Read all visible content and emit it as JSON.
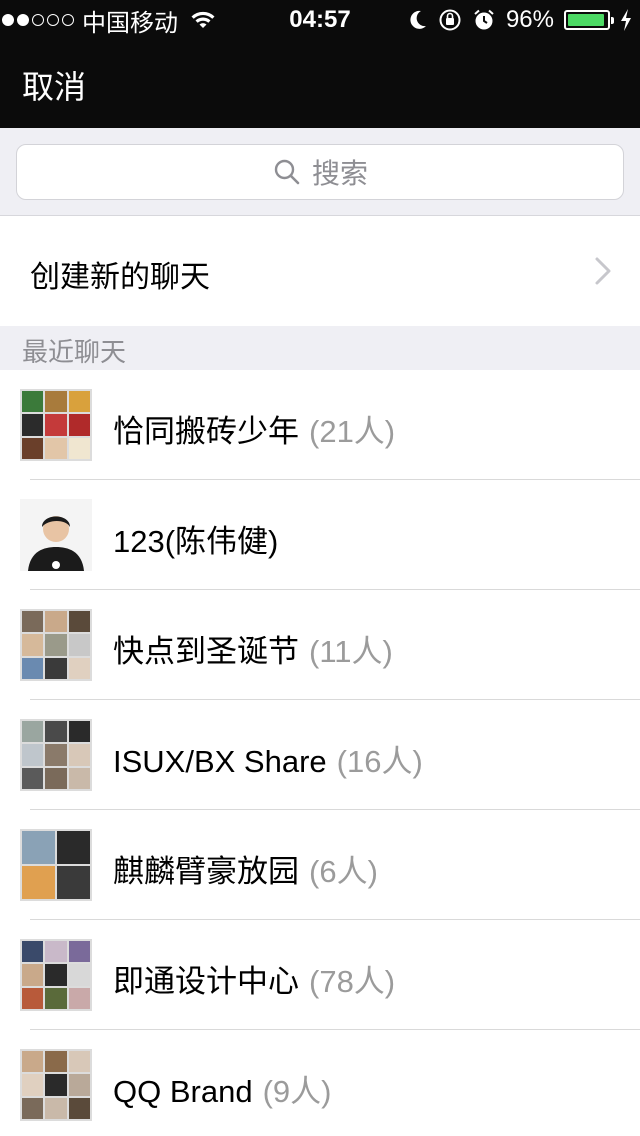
{
  "status_bar": {
    "signal_dots": [
      true,
      true,
      false,
      false,
      false
    ],
    "carrier": "中国移动",
    "time": "04:57",
    "battery_percent": "96%",
    "battery_level": 0.96,
    "icons": [
      "wifi-icon",
      "moon-icon",
      "rotation-lock-icon",
      "alarm-icon",
      "charging-icon"
    ]
  },
  "nav": {
    "cancel_label": "取消"
  },
  "search": {
    "placeholder": "搜索"
  },
  "create": {
    "label": "创建新的聊天"
  },
  "recent": {
    "title": "最近聊天"
  },
  "chats": [
    {
      "name": "恰同搬砖少年",
      "count": "(21人)",
      "grid": 3,
      "tiles": [
        "#3b7a3a",
        "#a87b3c",
        "#d9a13c",
        "#2b2b2b",
        "#c43a3a",
        "#b02a2a",
        "#6a3f2a",
        "#e2c6a8",
        "#f0e6d0"
      ]
    },
    {
      "name": "123(陈伟健)",
      "count": "",
      "grid": 1,
      "tiles": []
    },
    {
      "name": "快点到圣诞节",
      "count": "(11人)",
      "grid": 3,
      "tiles": [
        "#7a6a5a",
        "#c9a98a",
        "#5a4a3a",
        "#d6b99a",
        "#9a9a8a",
        "#c8c8c8",
        "#6a8ab0",
        "#3a3a3a",
        "#e0d0c0"
      ]
    },
    {
      "name": "ISUX/BX Share",
      "count": "(16人)",
      "grid": 3,
      "tiles": [
        "#9aa6a0",
        "#4a4a4a",
        "#2a2a2a",
        "#bfc6cc",
        "#8a7a6a",
        "#d8c8b8",
        "#5a5a5a",
        "#7a6a5a",
        "#c9b9a9"
      ]
    },
    {
      "name": "麒麟臂豪放园",
      "count": "(6人)",
      "grid": 2,
      "tiles": [
        "#8aa2b6",
        "#2a2a2a",
        "#e0a050",
        "#3a3a3a"
      ]
    },
    {
      "name": "即通设计中心",
      "count": "(78人)",
      "grid": 3,
      "tiles": [
        "#3a4a6a",
        "#c9b9c9",
        "#7a6a9a",
        "#c9a98a",
        "#2a2a2a",
        "#d8d8d8",
        "#b85a3a",
        "#5a6a3a",
        "#c9a9a9"
      ]
    },
    {
      "name": "QQ Brand",
      "count": "(9人)",
      "grid": 3,
      "tiles": [
        "#c9a98a",
        "#8a6a4a",
        "#d8c8b8",
        "#e0d0c0",
        "#2a2a2a",
        "#b9a999",
        "#7a6a5a",
        "#c9b9a9",
        "#5a4a3a"
      ]
    }
  ]
}
